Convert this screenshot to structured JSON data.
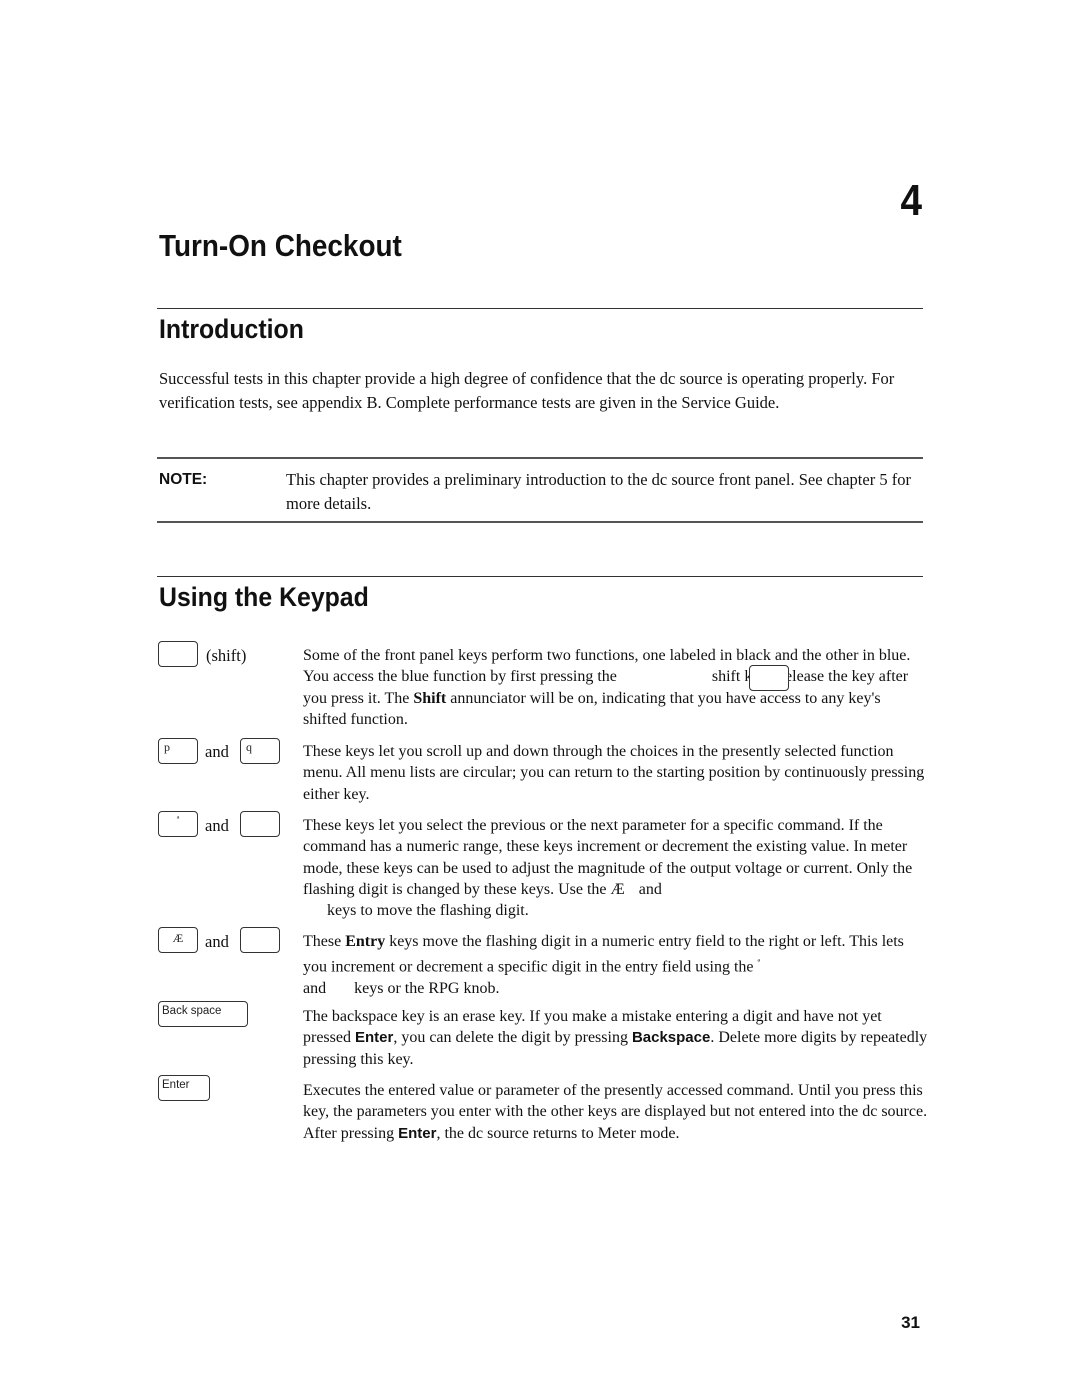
{
  "chapter": {
    "number": "4",
    "title": "Turn-On Checkout"
  },
  "introduction": {
    "heading": "Introduction",
    "body": "Successful tests in this chapter provide a high degree of confidence that the dc source is operating properly. For verification tests, see appendix B. Complete performance tests are given in the Service Guide.",
    "note_label": "NOTE:",
    "note_text": "This chapter provides a preliminary introduction to the dc source front panel. See chapter 5 for more details."
  },
  "keypad": {
    "heading": "Using the Keypad",
    "connector": "and",
    "items": [
      {
        "caption": "(shift)",
        "key_glyphs": [
          ""
        ],
        "text_parts": [
          "Some of the front panel keys perform two functions, one labeled in black and the other in blue. You access the blue function by first pressing the",
          "shift key. Release the key after you press it. The ",
          "Shift",
          " annunciator will be on, indicating that you have access to any key's shifted function."
        ]
      },
      {
        "key_glyphs": [
          "p",
          "q"
        ],
        "text": "These keys let you scroll up and down through the choices in the presently selected function menu. All menu lists are circular; you can return to the starting position by continuously pressing either key."
      },
      {
        "key_glyphs": [
          "ª",
          ""
        ],
        "text_parts": [
          "These keys let you select the previous or the next parameter for a specific command. If the command has a numeric range, these keys increment or decrement the existing value. In meter mode, these keys can be used to adjust the magnitude of the output voltage or current. Only the flashing digit is changed by these keys. Use the ",
          "Æ",
          " and",
          "keys to move the flashing digit."
        ]
      },
      {
        "key_glyphs": [
          "Æ",
          ""
        ],
        "text_parts": [
          "These ",
          "Entry",
          " keys move the flashing digit in a numeric entry field to the right or left. This lets you increment or decrement a specific digit in the entry field using the ",
          "ª",
          "and",
          "keys or the RPG knob."
        ]
      },
      {
        "key_label": "Back space",
        "text_parts": [
          "The backspace key is an erase key. If you make a mistake entering a digit and have not yet pressed ",
          "Enter",
          ", you can delete the digit by pressing ",
          "Backspace",
          ". Delete more digits by repeatedly pressing this key."
        ]
      },
      {
        "key_label": "Enter",
        "text_parts": [
          "Executes the entered value or parameter of the presently accessed command. Until you press this key, the parameters you enter with the other keys are displayed but not entered into the dc source. After pressing ",
          "Enter",
          ", the dc source returns to Meter mode."
        ]
      }
    ]
  },
  "page_number": "31"
}
